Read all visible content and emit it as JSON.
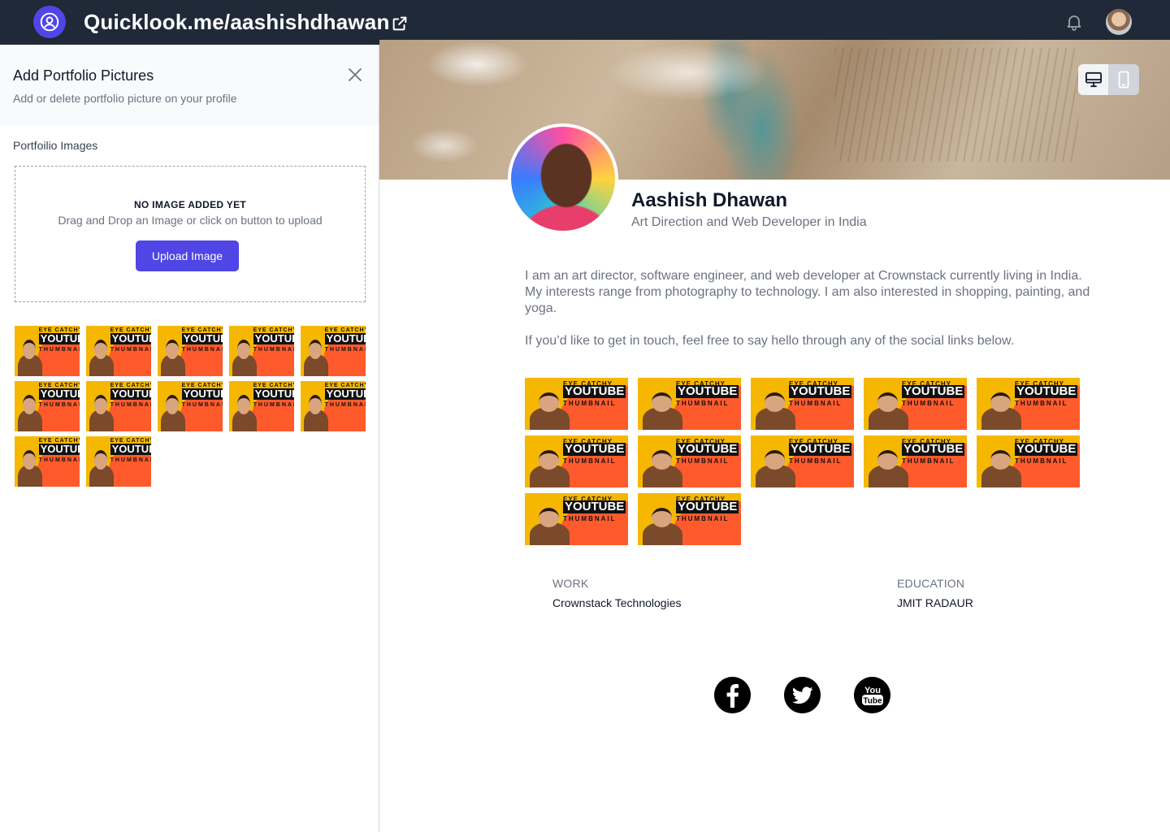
{
  "header": {
    "site_title": "Quicklook.me/aashishdhawan",
    "icons": {
      "logo": "user-circle-icon",
      "external": "external-link-icon",
      "bell": "bell-icon"
    }
  },
  "panel": {
    "title": "Add Portfolio Pictures",
    "subtitle": "Add or delete portfolio picture on your profile",
    "section_label": "Portfoilio Images",
    "dropzone": {
      "title": "NO IMAGE ADDED YET",
      "subtitle": "Drag and Drop an Image or click on button to upload",
      "button_label": "Upload Image"
    },
    "image_count": 12
  },
  "thumbnail": {
    "line1": "EYE CATCHY",
    "line2": "YOUTUBE",
    "line3": "THUMBNAIL"
  },
  "profile": {
    "name": "Aashish Dhawan",
    "role": "Art Direction and Web Developer in India",
    "bio1": "I am an art director, software engineer, and web developer at Crownstack currently living in India. My interests range from photography to technology. I am also interested in shopping, painting, and yoga.",
    "bio2": "If you’d like to get in touch, feel free to say hello through any of the social links below.",
    "work_label": "WORK",
    "work_value": "Crownstack Technologies",
    "education_label": "EDUCATION",
    "education_value": "JMIT RADAUR",
    "portfolio_count": 12
  },
  "social": {
    "facebook": "facebook-icon",
    "twitter": "twitter-icon",
    "youtube": "youtube-icon",
    "youtube_text_top": "You",
    "youtube_text_bottom": "Tube"
  },
  "colors": {
    "topbar": "#1f2937",
    "accent": "#4f46e5",
    "muted_text": "#6b7280"
  }
}
